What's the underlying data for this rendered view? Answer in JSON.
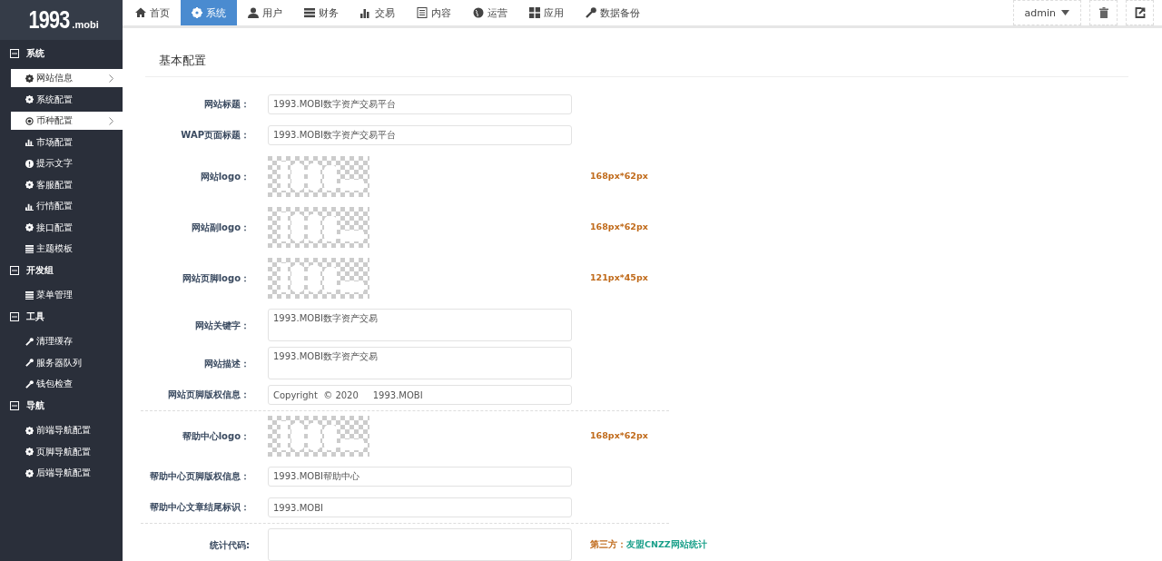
{
  "logo": {
    "main": "1993",
    "suffix": ".mobi"
  },
  "nav": [
    {
      "label": "首页",
      "kind": "home",
      "selected": false
    },
    {
      "label": "系统",
      "kind": "gear",
      "selected": true
    },
    {
      "label": "用户",
      "kind": "user",
      "selected": false
    },
    {
      "label": "财务",
      "kind": "list",
      "selected": false
    },
    {
      "label": "交易",
      "kind": "bars",
      "selected": false
    },
    {
      "label": "内容",
      "kind": "doc",
      "selected": false
    },
    {
      "label": "运营",
      "kind": "globe",
      "selected": false
    },
    {
      "label": "应用",
      "kind": "grid",
      "selected": false
    },
    {
      "label": "数据备份",
      "kind": "wrench",
      "selected": false
    }
  ],
  "user_menu": {
    "label": "admin"
  },
  "sidebar": [
    {
      "title": "系统",
      "expanded": true,
      "children": [
        {
          "label": "网站信息",
          "kind": "gear",
          "selected": true
        },
        {
          "label": "系统配置",
          "kind": "gear",
          "selected": false
        },
        {
          "label": "币种配置",
          "kind": "dot",
          "selected": true
        },
        {
          "label": "市场配置",
          "kind": "bars",
          "selected": false
        },
        {
          "label": "提示文字",
          "kind": "alert",
          "selected": false
        },
        {
          "label": "客服配置",
          "kind": "gear",
          "selected": false
        },
        {
          "label": "行情配置",
          "kind": "bars",
          "selected": false
        },
        {
          "label": "接口配置",
          "kind": "gear",
          "selected": false
        },
        {
          "label": "主题模板",
          "kind": "list",
          "selected": false
        }
      ]
    },
    {
      "title": "开发组",
      "expanded": true,
      "children": [
        {
          "label": "菜单管理",
          "kind": "list",
          "selected": false
        }
      ]
    },
    {
      "title": "工具",
      "expanded": true,
      "children": [
        {
          "label": "清理缓存",
          "kind": "wrench",
          "selected": false
        },
        {
          "label": "服务器队列",
          "kind": "wrench",
          "selected": false
        },
        {
          "label": "钱包检查",
          "kind": "wrench",
          "selected": false
        }
      ]
    },
    {
      "title": "导航",
      "expanded": true,
      "children": [
        {
          "label": "前端导航配置",
          "kind": "gear",
          "selected": false
        },
        {
          "label": "页脚导航配置",
          "kind": "gear",
          "selected": false
        },
        {
          "label": "后端导航配置",
          "kind": "gear",
          "selected": false
        }
      ]
    }
  ],
  "panel_title": "基本配置",
  "form": [
    {
      "kind": "text",
      "label": "网站标题：",
      "value": "1993.MOBI数字资产交易平台"
    },
    {
      "kind": "text",
      "label": "WAP页面标题：",
      "value": "1993.MOBI数字资产交易平台"
    },
    {
      "label": "网站logo：",
      "hint": "168px*62px"
    },
    {
      "label": "网站副logo：",
      "hint": "168px*62px"
    },
    {
      "label": "网站页脚logo：",
      "hint": "121px*45px"
    },
    {
      "kind": "textarea",
      "label": "网站关键字：",
      "value": "1993.MOBI数字资产交易"
    },
    {
      "kind": "textarea",
      "label": "网站描述：",
      "value": "1993.MOBI数字资产交易"
    },
    {
      "kind": "text",
      "label": "网站页脚版权信息：",
      "value": "Copyright  © 2020     1993.MOBI"
    },
    {
      "kind": "divider"
    },
    {
      "label": "帮助中心logo：",
      "hint": "168px*62px"
    },
    {
      "kind": "text",
      "label": "帮助中心页脚版权信息：",
      "value": "1993.MOBI帮助中心"
    },
    {
      "kind": "text",
      "label": "帮助中心文章结尾标识：",
      "value": "1993.MOBI"
    },
    {
      "kind": "divider"
    },
    {
      "kind": "code",
      "label": "统计代码:",
      "hint": "第三方：",
      "link": "友盟CNZZ网站统计"
    }
  ]
}
